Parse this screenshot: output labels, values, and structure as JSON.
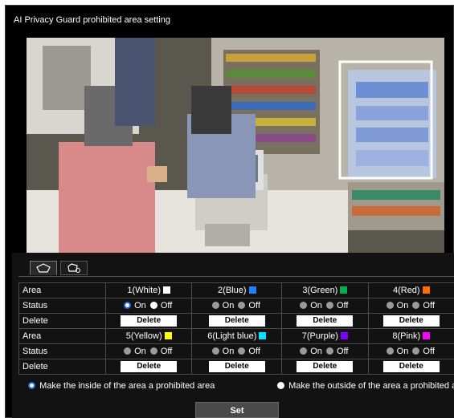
{
  "title": "AI Privacy Guard prohibited area setting",
  "tabs": [
    {
      "icon": "polygon-icon",
      "active": true
    },
    {
      "icon": "rotate-polygon-icon",
      "active": false
    }
  ],
  "labels": {
    "area": "Area",
    "status": "Status",
    "delete": "Delete"
  },
  "areas_row1": [
    {
      "name": "1(White)",
      "color": "#ffffff",
      "on_selected": true
    },
    {
      "name": "2(Blue)",
      "color": "#1e7fff",
      "on_selected": false
    },
    {
      "name": "3(Green)",
      "color": "#00b050",
      "on_selected": false
    },
    {
      "name": "4(Red)",
      "color": "#ff7000",
      "on_selected": false
    }
  ],
  "areas_row2": [
    {
      "name": "5(Yellow)",
      "color": "#ffff00",
      "on_selected": false
    },
    {
      "name": "6(Light blue)",
      "color": "#00e5ff",
      "on_selected": false
    },
    {
      "name": "7(Purple)",
      "color": "#8000ff",
      "on_selected": false
    },
    {
      "name": "8(Pink)",
      "color": "#ff00ff",
      "on_selected": false
    }
  ],
  "status_on": "On",
  "status_off": "Off",
  "delete_label": "Delete",
  "mode_inside": "Make the inside of the area a prohibited area",
  "mode_outside": "Make the outside of the area a prohibited area",
  "mode_selected": "inside",
  "set_label": "Set"
}
